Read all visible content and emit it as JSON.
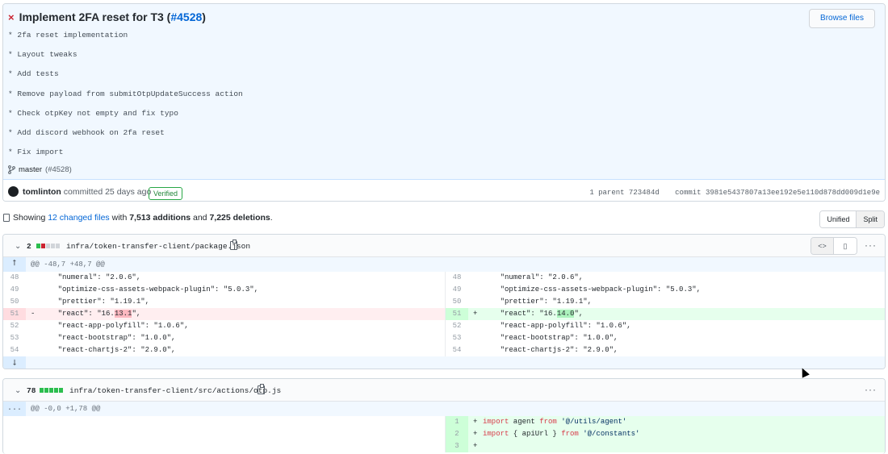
{
  "commit": {
    "fail_mark": "×",
    "title": "Implement 2FA reset for T3 (",
    "pr_link": "#4528",
    "title_close": ")",
    "browse_label": "Browse files",
    "message_lines": [
      "* 2fa reset implementation",
      "* Layout tweaks",
      "* Add tests",
      "* Remove payload from submitOtpUpdateSuccess action",
      "* Check otpKey not empty and fix typo",
      "* Add discord webhook on 2fa reset",
      "* Fix import"
    ],
    "branch": "master",
    "branch_pr": "(#4528)",
    "author": "tomlinton",
    "committed_text": "committed 25 days ago",
    "verified": "Verified",
    "parent_label": "1 parent 723484d",
    "commit_label": "commit 3981e5437807a13ee192e5e110d878dd009d1e9e"
  },
  "summary": {
    "prefix": "Showing",
    "files_link": "12 changed files",
    "with": "with",
    "additions": "7,513 additions",
    "and": "and",
    "deletions": "7,225 deletions",
    "period": "."
  },
  "view_toggle": {
    "unified": "Unified",
    "split": "Split"
  },
  "files": [
    {
      "count": "2",
      "blocks": [
        "#2cbe4e",
        "#cb2431",
        "#d1d5da",
        "#d1d5da",
        "#d1d5da"
      ],
      "path": "infra/token-transfer-client/package.json",
      "hunk": "@@ -48,7 +48,7 @@",
      "expander_top": "⭡",
      "expander_bottom": "⭣",
      "left": [
        {
          "ln": "48",
          "mk": "",
          "code": "    \"numeral\": \"2.0.6\","
        },
        {
          "ln": "49",
          "mk": "",
          "code": "    \"optimize-css-assets-webpack-plugin\": \"5.0.3\","
        },
        {
          "ln": "50",
          "mk": "",
          "code": "    \"prettier\": \"1.19.1\","
        },
        {
          "ln": "51",
          "mk": "-",
          "pre": "    \"react\": \"16.",
          "hl": "13.1",
          "post": "\",",
          "type": "del"
        },
        {
          "ln": "52",
          "mk": "",
          "code": "    \"react-app-polyfill\": \"1.0.6\","
        },
        {
          "ln": "53",
          "mk": "",
          "code": "    \"react-bootstrap\": \"1.0.0\","
        },
        {
          "ln": "54",
          "mk": "",
          "code": "    \"react-chartjs-2\": \"2.9.0\","
        }
      ],
      "right": [
        {
          "ln": "48",
          "mk": "",
          "code": "    \"numeral\": \"2.0.6\","
        },
        {
          "ln": "49",
          "mk": "",
          "code": "    \"optimize-css-assets-webpack-plugin\": \"5.0.3\","
        },
        {
          "ln": "50",
          "mk": "",
          "code": "    \"prettier\": \"1.19.1\","
        },
        {
          "ln": "51",
          "mk": "+",
          "pre": "    \"react\": \"16.",
          "hl": "14.0",
          "post": "\",",
          "type": "add"
        },
        {
          "ln": "52",
          "mk": "",
          "code": "    \"react-app-polyfill\": \"1.0.6\","
        },
        {
          "ln": "53",
          "mk": "",
          "code": "    \"react-bootstrap\": \"1.0.0\","
        },
        {
          "ln": "54",
          "mk": "",
          "code": "    \"react-chartjs-2\": \"2.9.0\","
        }
      ]
    },
    {
      "count": "78",
      "blocks": [
        "#2cbe4e",
        "#2cbe4e",
        "#2cbe4e",
        "#2cbe4e",
        "#2cbe4e"
      ],
      "path": "infra/token-transfer-client/src/actions/otp.js",
      "hunk": "@@ -0,0 +1,78 @@",
      "expander_top": "...",
      "right": [
        {
          "ln": "1",
          "mk": "+",
          "kw": "import",
          "mid": " agent ",
          "kw2": "from",
          "str": " '@/utils/agent'"
        },
        {
          "ln": "2",
          "mk": "+",
          "kw": "import",
          "mid": " { apiUrl } ",
          "kw2": "from",
          "str": " '@/constants'"
        },
        {
          "ln": "3",
          "mk": "+",
          "kw": "",
          "mid": "",
          "kw2": "",
          "str": ""
        }
      ]
    }
  ]
}
